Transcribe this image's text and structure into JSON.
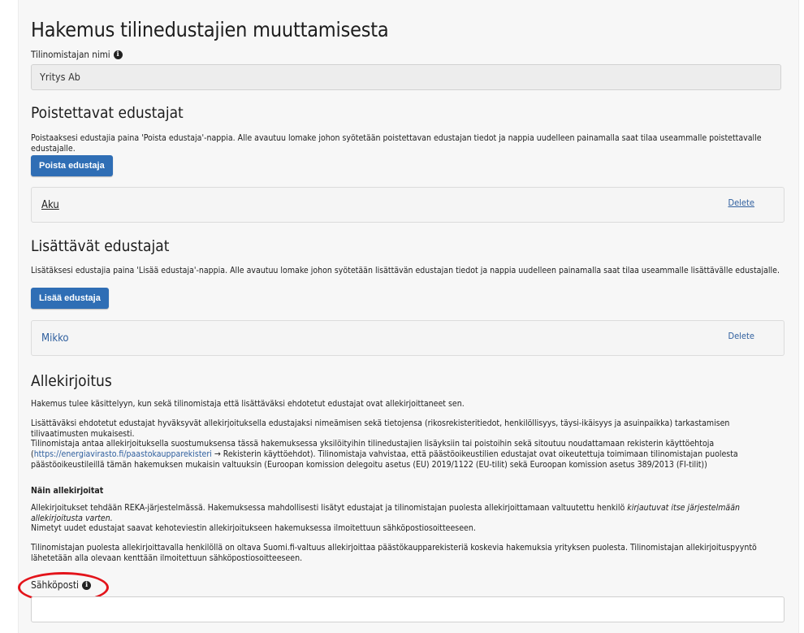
{
  "page": {
    "title": "Hakemus tilinedustajien muuttamisesta",
    "account_holder_label": "Tilinomistajan nimi",
    "account_holder_value": "Yritys Ab"
  },
  "removed": {
    "heading": "Poistettavat edustajat",
    "description": "Poistaaksesi edustajia paina 'Poista edustaja'-nappia. Alle avautuu lomake johon syötetään poistettavan edustajan tiedot ja nappia uudelleen painamalla saat tilaa useammalle poistettavalle edustajalle.",
    "button_label": "Poista edustaja",
    "items": [
      {
        "name": "Aku",
        "delete_label": "Delete"
      }
    ]
  },
  "added": {
    "heading": "Lisättävät edustajat",
    "description": "Lisätäksesi edustajia paina 'Lisää edustaja'-nappia. Alle avautuu lomake johon syötetään lisättävän edustajan tiedot ja nappia uudelleen painamalla saat tilaa useammalle lisättävälle edustajalle.",
    "button_label": "Lisää edustaja",
    "items": [
      {
        "name": "Mikko",
        "delete_label": "Delete"
      }
    ]
  },
  "signature": {
    "heading": "Allekirjoitus",
    "p1": "Hakemus tulee käsittelyyn, kun sekä tilinomistaja että lisättäväksi ehdotetut edustajat ovat allekirjoittaneet sen.",
    "p2": "Lisättäväksi ehdotetut edustajat hyväksyvät allekirjoituksella edustajaksi nimeämisen sekä tietojensa (rikosrekisteritiedot, henkilöllisyys, täysi-ikäisyys ja asuinpaikka) tarkastamisen tilivaatimusten mukaisesti.",
    "p3_a": "Tilinomistaja antaa allekirjoituksella suostumuksensa tässä hakemuksessa yksilöityihin tilinedustajien lisäyksiin tai poistoihin sekä sitoutuu noudattamaan rekisterin käyttöehtoja (",
    "p3_link": "https://energiavirasto.fi/paastokaupparekisteri",
    "p3_b": " → Rekisterin käyttöehdot). Tilinomistaja vahvistaa, että päästöoikeustilien edustajat ovat oikeutettuja toimimaan tilinomistajan puolesta päästöoikeustileillä tämän hakemuksen mukaisin valtuuksin (Euroopan komission delegoitu asetus (EU) 2019/1122 (EU-tilit) sekä Euroopan komission asetus 389/2013 (FI-tilit))",
    "how_heading": "Näin allekirjoitat",
    "p4_a": "Allekirjoitukset tehdään REKA-järjestelmässä. Hakemuksessa mahdollisesti lisätyt edustajat ja tilinomistajan puolesta allekirjoittamaan valtuutettu henkilö ",
    "p4_em": "kirjautuvat itse järjestelmään allekirjoitusta varten.",
    "p5": "Nimetyt uudet edustajat saavat kehoteviestin allekirjoitukseen hakemuksessa ilmoitettuun sähköpostiosoitteeseen.",
    "p6": "Tilinomistajan puolesta allekirjoittavalla henkilöllä on oltava Suomi.fi-valtuus allekirjoittaa päästökauppa­rekisteriä koskevia hakemuksia yrityksen puolesta. Tilinomistajan allekirjoituspyyntö lähetetään alla olevaan kenttään ilmoitettuun sähköpostiosoitteeseen.",
    "email_label": "Sähköposti",
    "email_value": ""
  },
  "icons": {
    "info": "info-circle-icon"
  },
  "colors": {
    "primary_button": "#2f6eb5",
    "link": "#2f5f9e",
    "annotation": "#e3141b"
  }
}
